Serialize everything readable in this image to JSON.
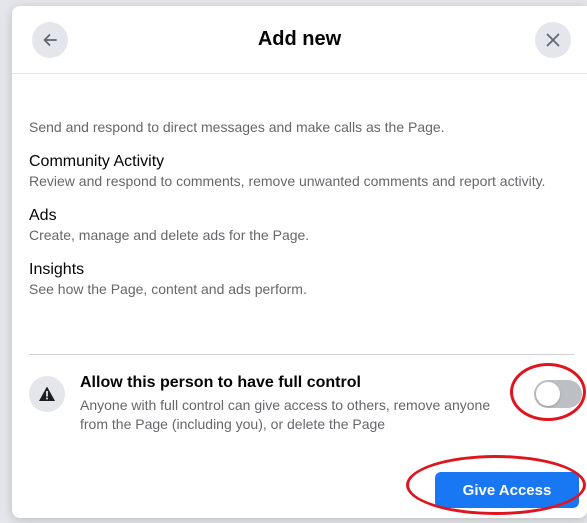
{
  "backdrop": {
    "partial_text": ""
  },
  "dialog": {
    "title": "Add new",
    "back_icon": "arrow-left-icon",
    "close_icon": "close-icon",
    "messages_desc": "Send and respond to direct messages and make calls as the Page.",
    "permissions": [
      {
        "title": "Community Activity",
        "desc": "Review and respond to comments, remove unwanted comments and report activity."
      },
      {
        "title": "Ads",
        "desc": "Create, manage and delete ads for the Page."
      },
      {
        "title": "Insights",
        "desc": "See how the Page, content and ads perform."
      }
    ],
    "full_control": {
      "icon": "warning-icon",
      "title": "Allow this person to have full control",
      "desc": "Anyone with full control can give access to others, remove anyone from the Page (including you), or delete the Page",
      "enabled": false
    },
    "give_access_label": "Give Access"
  },
  "colors": {
    "primary": "#1877f2",
    "annotation": "#e0141e",
    "toggle_off": "#bcc0c4",
    "secondary_text": "#65676b"
  }
}
